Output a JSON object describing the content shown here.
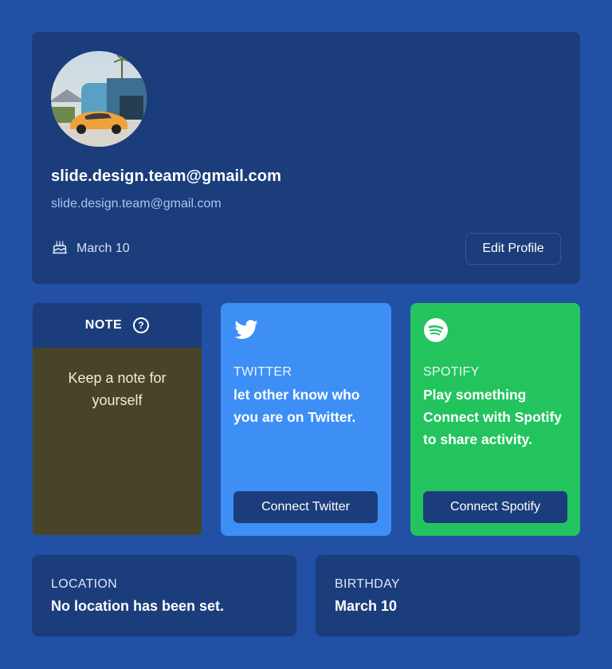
{
  "profile": {
    "display_name": "slide.design.team@gmail.com",
    "email": "slide.design.team@gmail.com",
    "birthday": "March 10",
    "edit_label": "Edit Profile",
    "avatar_icon": "avatar-photo"
  },
  "note": {
    "title": "NOTE",
    "help_icon": "?",
    "placeholder": "Keep a note for yourself"
  },
  "twitter": {
    "label": "TWITTER",
    "description": "let other know who you are on Twitter.",
    "button": "Connect Twitter",
    "icon": "twitter-bird-icon",
    "color": "#3d8ff6"
  },
  "spotify": {
    "label": "SPOTIFY",
    "description": "Play something Connect with Spotify to share activity.",
    "button": "Connect Spotify",
    "icon": "spotify-icon",
    "color": "#23c45d"
  },
  "location": {
    "label": "LOCATION",
    "value": "No location has been set."
  },
  "birthday": {
    "label": "BIRTHDAY",
    "value": "March 10"
  },
  "colors": {
    "background": "#2150a4",
    "card": "#1c3d7b",
    "note_body": "#484427"
  }
}
